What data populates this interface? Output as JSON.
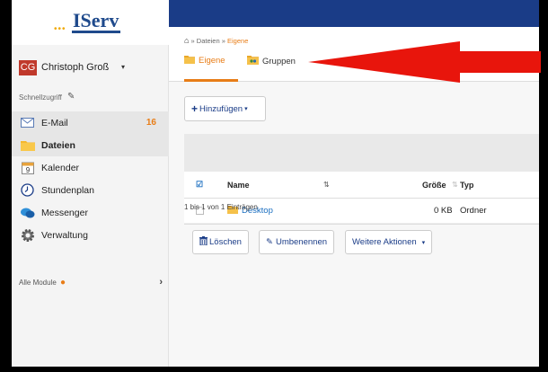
{
  "logo": {
    "dots": "•••",
    "text": "IServ"
  },
  "user": {
    "initials": "CG",
    "name": "Christoph Groß",
    "caret": "▾"
  },
  "quick_access": {
    "label": "Schnellzugriff"
  },
  "nav": {
    "items": [
      {
        "label": "E-Mail",
        "badge": "16",
        "icon": "mail-icon"
      },
      {
        "label": "Dateien",
        "icon": "folder-icon"
      },
      {
        "label": "Kalender",
        "icon": "calendar-icon",
        "icon_text": "9"
      },
      {
        "label": "Stundenplan",
        "icon": "clock-icon"
      },
      {
        "label": "Messenger",
        "icon": "chat-icon"
      },
      {
        "label": "Verwaltung",
        "icon": "gear-icon"
      }
    ]
  },
  "all_modules": {
    "label": "Alle Module",
    "dot": "●",
    "arrow": "›"
  },
  "breadcrumb": {
    "sep1": "»",
    "part1": "Dateien",
    "sep2": "»",
    "current": "Eigene"
  },
  "tabs": {
    "own": "Eigene",
    "groups": "Gruppen"
  },
  "add_button": {
    "plus": "+",
    "label": "Hinzufügen",
    "caret": "▾"
  },
  "table": {
    "headers": {
      "check": "☑",
      "name": "Name",
      "name_sort": "⇅",
      "size": "Größe",
      "size_sort": "⇅",
      "type": "Typ"
    },
    "rows": [
      {
        "name": "Desktop",
        "size": "0 KB",
        "type": "Ordner"
      }
    ]
  },
  "actions": {
    "delete": "Löschen",
    "rename": "Umbenennen",
    "more": "Weitere Aktionen",
    "more_caret": "▾"
  },
  "entries": "1 bis 1 von 1 Einträgen",
  "colors": {
    "accent": "#e87d17",
    "brand": "#1a3c87",
    "annotation_arrow": "#e8150c"
  }
}
